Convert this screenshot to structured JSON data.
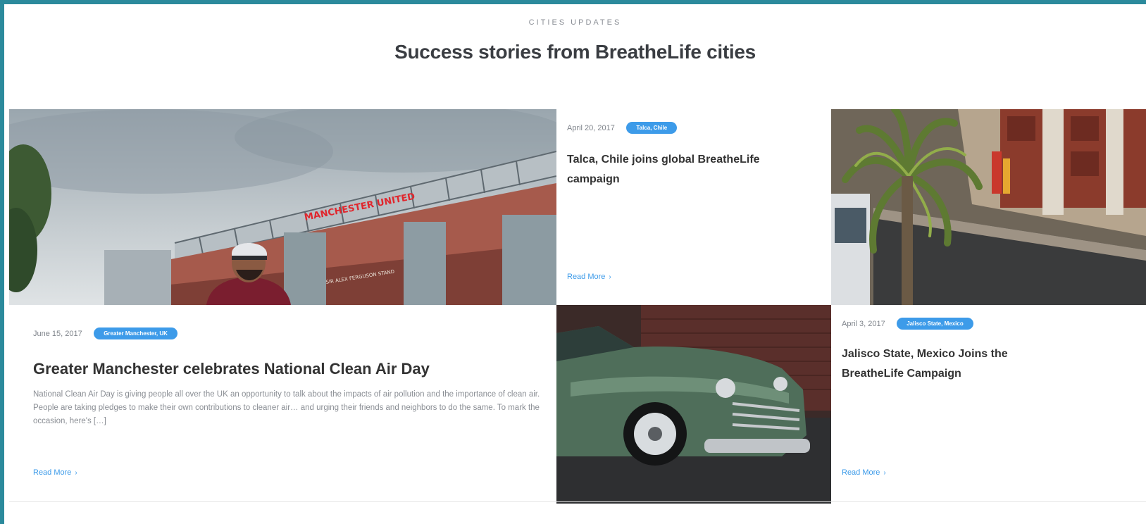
{
  "section": {
    "eyebrow": "CITIES UPDATES",
    "heading": "Success stories from BreatheLife cities"
  },
  "cards": {
    "manchester": {
      "image": "cyclist-in-front-of-manchester-united-stadium",
      "stadium_sign": "MANCHESTER UNITED",
      "stand_sign": "SIR ALEX FERGUSON STAND",
      "date": "June 15, 2017",
      "tag": "Greater Manchester, UK",
      "title": "Greater Manchester celebrates National Clean Air Day",
      "excerpt": "National Clean Air Day is giving people all over the UK an opportunity to talk about the impacts of air pollution and the importance of clean air. People are taking pledges to make their own contributions to cleaner air… and urging their friends and neighbors to do the same.   To mark the occasion, here's […]",
      "read_more": "Read More"
    },
    "talca": {
      "date": "April 20, 2017",
      "tag": "Talca, Chile",
      "title": "Talca, Chile joins global BreatheLife campaign",
      "read_more": "Read More",
      "image": "palm-tree-street-aerial"
    },
    "jalisco": {
      "date": "April 3, 2017",
      "tag": "Jalisco State, Mexico",
      "title": "Jalisco State, Mexico Joins the BreatheLife Campaign",
      "read_more": "Read More",
      "image": "vintage-green-car"
    }
  },
  "colors": {
    "frame": "#2b8a9c",
    "accent": "#3d9be9",
    "heading": "#3a3d42"
  },
  "icons": {
    "read_more": "chevron-right-icon"
  }
}
